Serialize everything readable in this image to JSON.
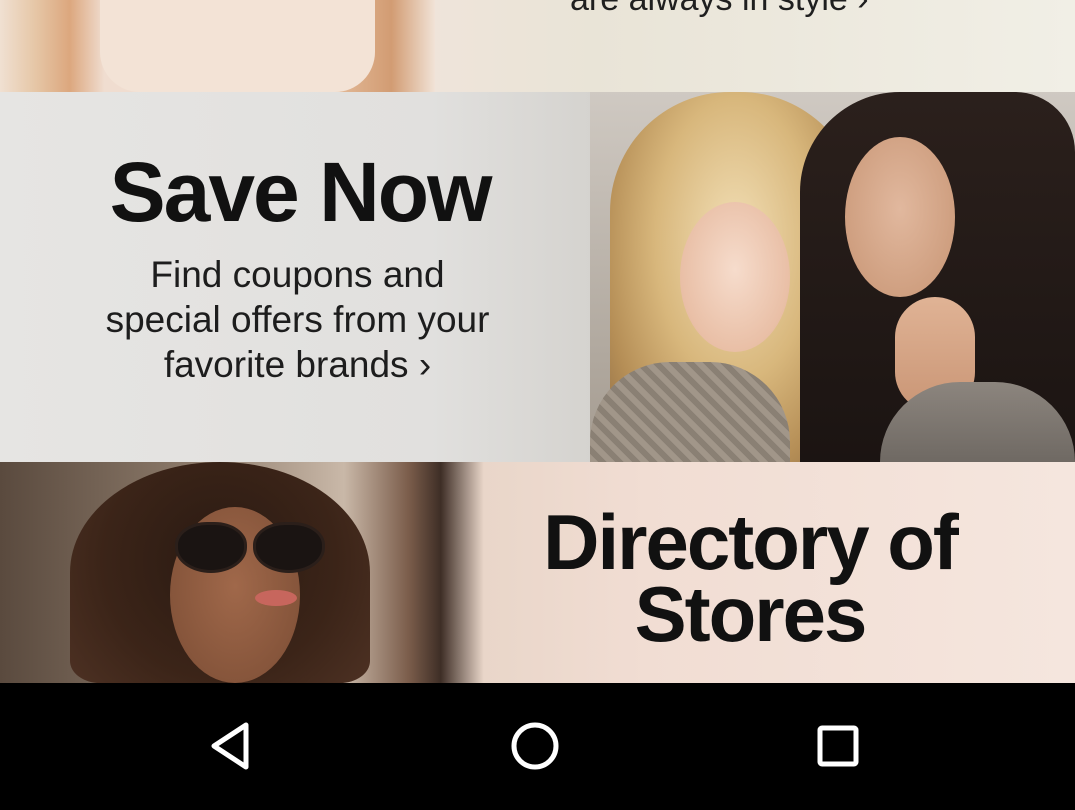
{
  "banners": {
    "top": {
      "cut_text": "are always in style ›"
    },
    "save_now": {
      "title": "Save Now",
      "subtitle_line1": "Find coupons and",
      "subtitle_line2": "special offers from your",
      "subtitle_line3": "favorite brands ›"
    },
    "directory": {
      "title_line1": "Directory of",
      "title_line2": "Stores"
    }
  },
  "navbar": {
    "back_icon": "back-triangle-icon",
    "home_icon": "home-circle-icon",
    "recents_icon": "recents-square-icon"
  },
  "colors": {
    "text_dark": "#111111",
    "navbar_bg": "#000000",
    "nav_icon": "#ffffff"
  }
}
